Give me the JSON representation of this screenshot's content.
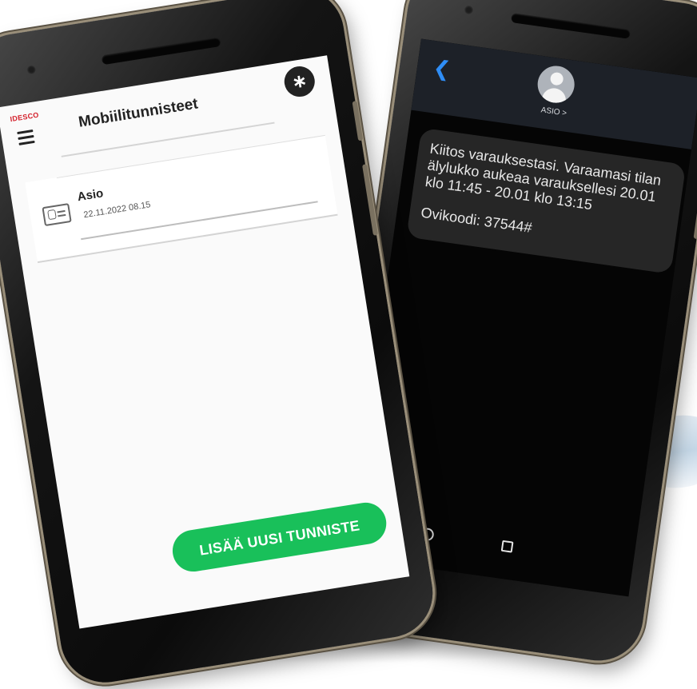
{
  "left_app": {
    "logo": "IDESCO",
    "title": "Mobiilitunnisteet",
    "bluetooth_icon": "bluetooth-icon",
    "menu_icon": "hamburger-menu-icon",
    "credential": {
      "name": "Asio",
      "date": "22.11.2022 08.15",
      "icon": "id-card-icon"
    },
    "add_button_label": "LISÄÄ UUSI TUNNISTE"
  },
  "sms": {
    "back_icon": "chevron-left-icon",
    "contact_name": "ASIO >",
    "message_text": "Kiitos varauksestasi. Varaamasi tilan älylukko aukeaa varauksellesi  20.01 klo 11:45 - 20.01 klo 13:15",
    "door_code": "Ovikoodi: 37544#"
  },
  "colors": {
    "brand_red": "#d41f2a",
    "button_green": "#19c05a",
    "ios_blue": "#2f8df5",
    "sms_bubble": "#262626"
  }
}
